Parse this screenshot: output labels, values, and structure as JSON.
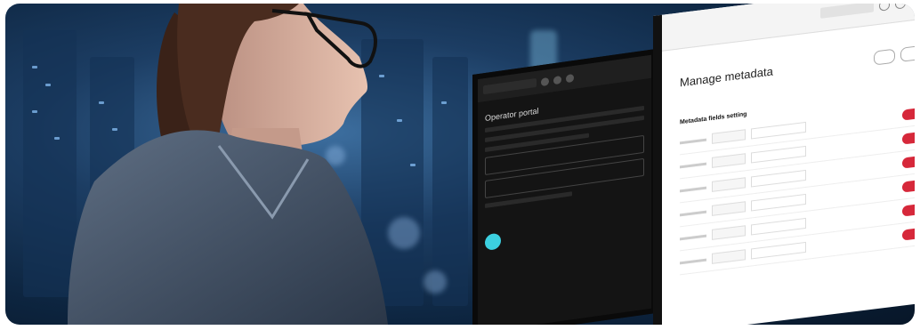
{
  "scene": {
    "description_type": "photo",
    "dark_monitor": {
      "page_title": "Operator portal",
      "colors": {
        "background": "#141414",
        "accent": "#3cd0e0"
      }
    },
    "light_monitor": {
      "page_title": "Manage metadata",
      "section_title": "Metadata fields setting",
      "colors": {
        "background": "#ffffff",
        "delete_button": "#d6283a"
      }
    }
  }
}
